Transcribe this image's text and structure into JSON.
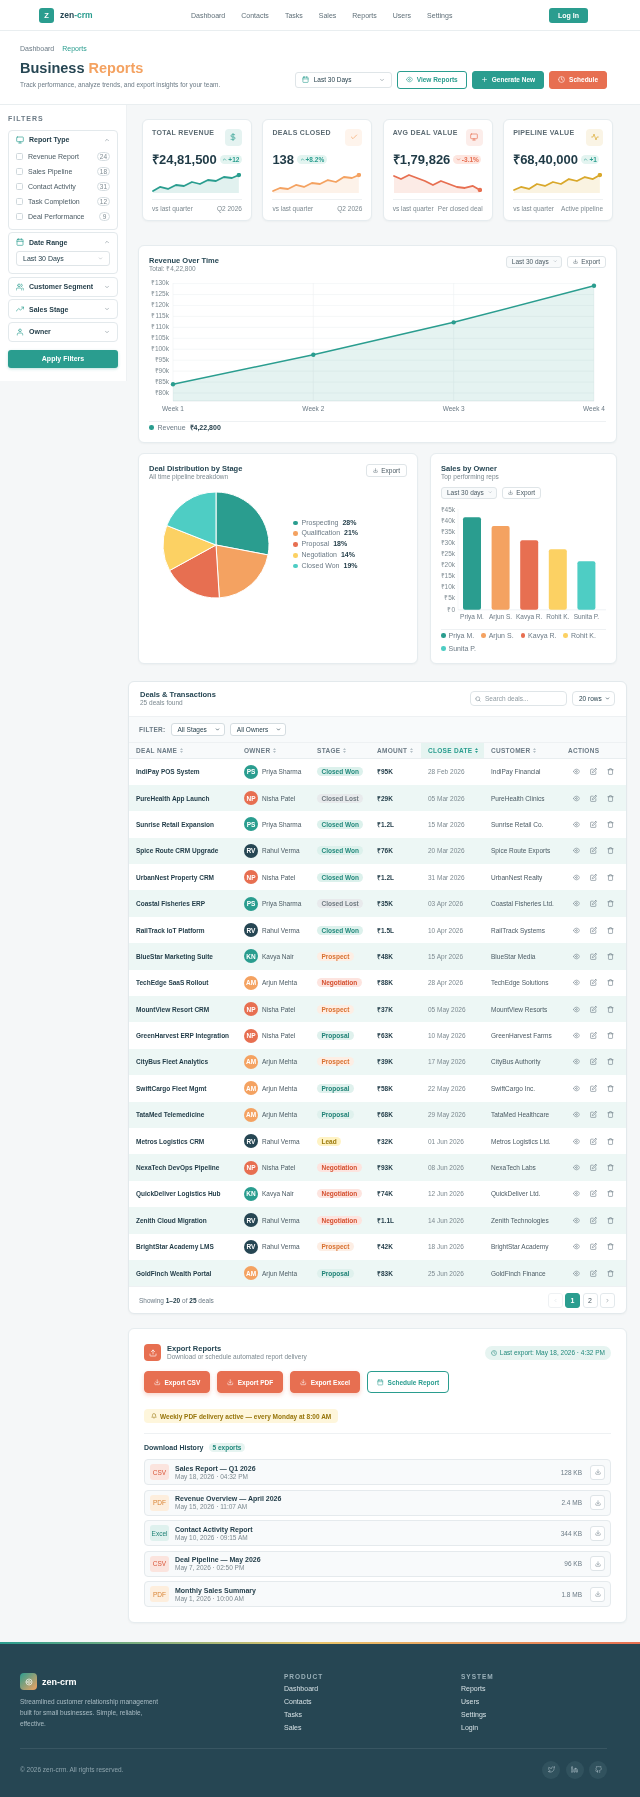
{
  "header": {
    "logo_letter": "Z",
    "brand": {
      "text": "zen",
      "accent": "-crm"
    },
    "nav": [
      {
        "label": "Dashboard",
        "selected": false
      },
      {
        "label": "Contacts",
        "selected": false
      },
      {
        "label": "Tasks",
        "selected": false
      },
      {
        "label": "Sales",
        "selected": false
      },
      {
        "label": "Reports",
        "selected": false
      },
      {
        "label": "Users",
        "selected": false
      },
      {
        "label": "Settings",
        "selected": false
      }
    ],
    "login": "Log In"
  },
  "page_header": {
    "breadcrumb": [
      {
        "label": "Dashboard",
        "current": false
      },
      {
        "label": "Reports",
        "current": true
      }
    ],
    "title": {
      "text": "Business",
      "accent": "Reports"
    },
    "subtitle": "Track performance, analyze trends, and export insights for your team.",
    "date_select": "Last 30 Days",
    "buttons": [
      {
        "label": "View Reports",
        "kind": "outline"
      },
      {
        "label": "Generate New",
        "kind": "primary"
      },
      {
        "label": "Schedule",
        "kind": "accent"
      }
    ]
  },
  "sidebar": {
    "heading": "FILTERS",
    "groups": [
      {
        "title": "Report Type",
        "expanded": true,
        "kind": "checklist",
        "options": [
          {
            "label": "Revenue Report",
            "count": "24",
            "checked": false
          },
          {
            "label": "Sales Pipeline",
            "count": "18",
            "checked": false
          },
          {
            "label": "Contact Activity",
            "count": "31",
            "checked": false
          },
          {
            "label": "Task Completion",
            "count": "12",
            "checked": false
          },
          {
            "label": "Deal Performance",
            "count": "9",
            "checked": false
          }
        ]
      },
      {
        "title": "Date Range",
        "expanded": true,
        "kind": "select",
        "value": "Last 30 Days"
      },
      {
        "title": "Customer Segment",
        "expanded": false
      },
      {
        "title": "Sales Stage",
        "expanded": false
      },
      {
        "title": "Owner",
        "expanded": false
      }
    ],
    "apply": "Apply Filters"
  },
  "kpis": [
    {
      "label": "TOTAL REVENUE",
      "value": "₹24,81,500",
      "delta": "+12",
      "rising": true,
      "color": "#2a9d8f",
      "note_left": "vs last quarter",
      "note_right": "Q2 2026"
    },
    {
      "label": "DEALS CLOSED",
      "value": "138",
      "delta": "+8.2%",
      "rising": true,
      "color": "#f4a261",
      "note_left": "vs last quarter",
      "note_right": "Q2 2026"
    },
    {
      "label": "AVG DEAL VALUE",
      "value": "₹1,79,826",
      "delta": "-3.1%",
      "rising": false,
      "color": "#e76f51",
      "note_left": "vs last quarter",
      "note_right": "Per closed deal"
    },
    {
      "label": "PIPELINE VALUE",
      "value": "₹68,40,000",
      "delta": "+1",
      "rising": true,
      "color": "#d9a82b",
      "note_left": "vs last quarter",
      "note_right": "Active pipeline"
    }
  ],
  "revenue_chart": {
    "subtitle": "Total: ₹4,22,800",
    "range_select": "Last 30 days",
    "export": "Export",
    "legend_value": "₹4,22,800",
    "chart_data": {
      "type": "area",
      "title": "Revenue Over Time",
      "categories": [
        "Week 1",
        "Week 2",
        "Week 3",
        "Week 4"
      ],
      "series": [
        {
          "name": "Revenue",
          "color": "#2a9d8f",
          "values": [
            84000,
            97500,
            112300,
            129000
          ]
        }
      ],
      "ylim": [
        80000,
        130000
      ],
      "yticks": [
        {
          "value": 80000,
          "label": "₹80k"
        },
        {
          "value": 85000,
          "label": "₹85k"
        },
        {
          "value": 90000,
          "label": "₹90k"
        },
        {
          "value": 95000,
          "label": "₹95k"
        },
        {
          "value": 100000,
          "label": "₹100k"
        },
        {
          "value": 105000,
          "label": "₹105k"
        },
        {
          "value": 110000,
          "label": "₹110k"
        },
        {
          "value": 115000,
          "label": "₹115k"
        },
        {
          "value": 120000,
          "label": "₹120k"
        },
        {
          "value": 125000,
          "label": "₹125k"
        },
        {
          "value": 130000,
          "label": "₹130k"
        }
      ],
      "grid": true,
      "legend": "bottom"
    }
  },
  "deal_distribution": {
    "subtitle": "All time pipeline breakdown",
    "export": "Export",
    "chart_data": {
      "type": "pie",
      "title": "Deal Distribution by Stage",
      "categories": [
        "Prospecting",
        "Qualification",
        "Proposal",
        "Negotiation",
        "Closed Won"
      ],
      "values": [
        28,
        21,
        18,
        14,
        19
      ],
      "legend": "right"
    },
    "legend_items": [
      {
        "value": "28%",
        "color": "#2a9d8f"
      },
      {
        "value": "21%",
        "color": "#f4a261"
      },
      {
        "value": "18%",
        "color": "#e76f51"
      },
      {
        "value": "14%",
        "color": "#fcd163"
      },
      {
        "value": "19%",
        "color": "#4ecdc4"
      }
    ]
  },
  "sales_by_owner": {
    "subtitle": "Top performing reps",
    "range_select": "Last 30 days",
    "export": "Export",
    "chart_data": {
      "type": "bar",
      "title": "Sales by Owner",
      "categories": [
        "Priya M.",
        "Arjun S.",
        "Kavya R.",
        "Rohit K.",
        "Sunita P."
      ],
      "values": [
        42000,
        38000,
        31500,
        27500,
        22000
      ],
      "ylim": [
        0,
        45000
      ],
      "yticks": [
        {
          "value": 0,
          "label": "₹0"
        },
        {
          "value": 5000,
          "label": "₹5k"
        },
        {
          "value": 10000,
          "label": "₹10k"
        },
        {
          "value": 15000,
          "label": "₹15k"
        },
        {
          "value": 20000,
          "label": "₹20k"
        },
        {
          "value": 25000,
          "label": "₹25k"
        },
        {
          "value": 30000,
          "label": "₹30k"
        },
        {
          "value": 35000,
          "label": "₹35k"
        },
        {
          "value": 40000,
          "label": "₹40k"
        },
        {
          "value": 45000,
          "label": "₹45k"
        }
      ]
    },
    "legend_items": [
      {
        "label": "Priya M.",
        "color": "#2a9d8f"
      },
      {
        "label": "Arjun S.",
        "color": "#f4a261"
      },
      {
        "label": "Kavya R.",
        "color": "#e76f51"
      },
      {
        "label": "Rohit K.",
        "color": "#fcd163"
      },
      {
        "label": "Sunita P.",
        "color": "#4ecdc4"
      }
    ]
  },
  "deals_table": {
    "title": "Deals & Transactions",
    "count": "25 deals found",
    "search_placeholder": "Search deals...",
    "rows_select": "20 rows",
    "filter_label": "FILTER:",
    "filters": [
      "All Stages",
      "All Owners"
    ],
    "columns": [
      {
        "label": "DEAL NAME",
        "sortable": true,
        "sorted": false
      },
      {
        "label": "OWNER",
        "sortable": true,
        "sorted": false
      },
      {
        "label": "STAGE",
        "sortable": true,
        "sorted": false
      },
      {
        "label": "AMOUNT",
        "sortable": true,
        "sorted": false
      },
      {
        "label": "CLOSE DATE",
        "sortable": true,
        "sorted": true
      },
      {
        "label": "CUSTOMER",
        "sortable": true,
        "sorted": false
      },
      {
        "label": "ACTIONS",
        "sortable": false,
        "sorted": false
      }
    ],
    "rows": [
      {
        "deal": "IndiPay POS System",
        "owner": {
          "initials": "PS",
          "name": "Priya Sharma",
          "color": "#2a9d8f"
        },
        "stage": {
          "label": "Closed Won",
          "kind": "won"
        },
        "amount": "₹95K",
        "close_date": "28 Feb 2026",
        "customer": "IndiPay Financial"
      },
      {
        "deal": "PureHealth App Launch",
        "owner": {
          "initials": "NP",
          "name": "Nisha Patel",
          "color": "#e76f51"
        },
        "stage": {
          "label": "Closed Lost",
          "kind": "lost"
        },
        "amount": "₹29K",
        "close_date": "05 Mar 2026",
        "customer": "PureHealth Clinics"
      },
      {
        "deal": "Sunrise Retail Expansion",
        "owner": {
          "initials": "PS",
          "name": "Priya Sharma",
          "color": "#2a9d8f"
        },
        "stage": {
          "label": "Closed Won",
          "kind": "won"
        },
        "amount": "₹1.2L",
        "close_date": "15 Mar 2026",
        "customer": "Sunrise Retail Co."
      },
      {
        "deal": "Spice Route CRM Upgrade",
        "owner": {
          "initials": "RV",
          "name": "Rahul Verma",
          "color": "#264653"
        },
        "stage": {
          "label": "Closed Won",
          "kind": "won"
        },
        "amount": "₹76K",
        "close_date": "20 Mar 2026",
        "customer": "Spice Route Exports"
      },
      {
        "deal": "UrbanNest Property CRM",
        "owner": {
          "initials": "NP",
          "name": "Nisha Patel",
          "color": "#e76f51"
        },
        "stage": {
          "label": "Closed Won",
          "kind": "won"
        },
        "amount": "₹1.2L",
        "close_date": "31 Mar 2026",
        "customer": "UrbanNest Realty"
      },
      {
        "deal": "Coastal Fisheries ERP",
        "owner": {
          "initials": "PS",
          "name": "Priya Sharma",
          "color": "#2a9d8f"
        },
        "stage": {
          "label": "Closed Lost",
          "kind": "lost"
        },
        "amount": "₹35K",
        "close_date": "03 Apr 2026",
        "customer": "Coastal Fisheries Ltd."
      },
      {
        "deal": "RailTrack IoT Platform",
        "owner": {
          "initials": "RV",
          "name": "Rahul Verma",
          "color": "#264653"
        },
        "stage": {
          "label": "Closed Won",
          "kind": "won"
        },
        "amount": "₹1.5L",
        "close_date": "10 Apr 2026",
        "customer": "RailTrack Systems"
      },
      {
        "deal": "BlueStar Marketing Suite",
        "owner": {
          "initials": "KN",
          "name": "Kavya Nair",
          "color": "#2a9d8f"
        },
        "stage": {
          "label": "Prospect",
          "kind": "prospect"
        },
        "amount": "₹48K",
        "close_date": "15 Apr 2026",
        "customer": "BlueStar Media"
      },
      {
        "deal": "TechEdge SaaS Rollout",
        "owner": {
          "initials": "AM",
          "name": "Arjun Mehta",
          "color": "#f4a261"
        },
        "stage": {
          "label": "Negotiation",
          "kind": "negotiation"
        },
        "amount": "₹88K",
        "close_date": "28 Apr 2026",
        "customer": "TechEdge Solutions"
      },
      {
        "deal": "MountView Resort CRM",
        "owner": {
          "initials": "NP",
          "name": "Nisha Patel",
          "color": "#e76f51"
        },
        "stage": {
          "label": "Prospect",
          "kind": "prospect"
        },
        "amount": "₹37K",
        "close_date": "05 May 2026",
        "customer": "MountView Resorts"
      },
      {
        "deal": "GreenHarvest ERP Integration",
        "owner": {
          "initials": "NP",
          "name": "Nisha Patel",
          "color": "#e76f51"
        },
        "stage": {
          "label": "Proposal",
          "kind": "proposal"
        },
        "amount": "₹63K",
        "close_date": "10 May 2026",
        "customer": "GreenHarvest Farms"
      },
      {
        "deal": "CityBus Fleet Analytics",
        "owner": {
          "initials": "AM",
          "name": "Arjun Mehta",
          "color": "#f4a261"
        },
        "stage": {
          "label": "Prospect",
          "kind": "prospect"
        },
        "amount": "₹39K",
        "close_date": "17 May 2026",
        "customer": "CityBus Authority"
      },
      {
        "deal": "SwiftCargo Fleet Mgmt",
        "owner": {
          "initials": "AM",
          "name": "Arjun Mehta",
          "color": "#f4a261"
        },
        "stage": {
          "label": "Proposal",
          "kind": "proposal"
        },
        "amount": "₹58K",
        "close_date": "22 May 2026",
        "customer": "SwiftCargo Inc."
      },
      {
        "deal": "TataMed Telemedicine",
        "owner": {
          "initials": "AM",
          "name": "Arjun Mehta",
          "color": "#f4a261"
        },
        "stage": {
          "label": "Proposal",
          "kind": "proposal"
        },
        "amount": "₹68K",
        "close_date": "29 May 2026",
        "customer": "TataMed Healthcare"
      },
      {
        "deal": "Metros Logistics CRM",
        "owner": {
          "initials": "RV",
          "name": "Rahul Verma",
          "color": "#264653"
        },
        "stage": {
          "label": "Lead",
          "kind": "lead"
        },
        "amount": "₹32K",
        "close_date": "01 Jun 2026",
        "customer": "Metros Logistics Ltd."
      },
      {
        "deal": "NexaTech DevOps Pipeline",
        "owner": {
          "initials": "NP",
          "name": "Nisha Patel",
          "color": "#e76f51"
        },
        "stage": {
          "label": "Negotiation",
          "kind": "negotiation"
        },
        "amount": "₹93K",
        "close_date": "08 Jun 2026",
        "customer": "NexaTech Labs"
      },
      {
        "deal": "QuickDeliver Logistics Hub",
        "owner": {
          "initials": "KN",
          "name": "Kavya Nair",
          "color": "#2a9d8f"
        },
        "stage": {
          "label": "Negotiation",
          "kind": "negotiation"
        },
        "amount": "₹74K",
        "close_date": "12 Jun 2026",
        "customer": "QuickDeliver Ltd."
      },
      {
        "deal": "Zenith Cloud Migration",
        "owner": {
          "initials": "RV",
          "name": "Rahul Verma",
          "color": "#264653"
        },
        "stage": {
          "label": "Negotiation",
          "kind": "negotiation"
        },
        "amount": "₹1.1L",
        "close_date": "14 Jun 2026",
        "customer": "Zenith Technologies"
      },
      {
        "deal": "BrightStar Academy LMS",
        "owner": {
          "initials": "RV",
          "name": "Rahul Verma",
          "color": "#264653"
        },
        "stage": {
          "label": "Prospect",
          "kind": "prospect"
        },
        "amount": "₹42K",
        "close_date": "18 Jun 2026",
        "customer": "BrightStar Academy"
      },
      {
        "deal": "GoldFinch Wealth Portal",
        "owner": {
          "initials": "AM",
          "name": "Arjun Mehta",
          "color": "#f4a261"
        },
        "stage": {
          "label": "Proposal",
          "kind": "proposal"
        },
        "amount": "₹83K",
        "close_date": "25 Jun 2026",
        "customer": "GoldFinch Finance"
      }
    ],
    "summary": "Showing **1–20** of **25** deals",
    "pagination": {
      "prev": {
        "disabled": true
      },
      "pages": [
        {
          "label": "1",
          "selected": true
        },
        {
          "label": "2",
          "selected": false
        }
      ],
      "next": {
        "disabled": false
      }
    }
  },
  "export_reports": {
    "title": "Export Reports",
    "subtitle": "Download or schedule automated report delivery",
    "last_export": "Last export: May 18, 2026 · 4:32 PM",
    "buttons": [
      {
        "label": "Export CSV",
        "kind": "solid"
      },
      {
        "label": "Export PDF",
        "kind": "solid"
      },
      {
        "label": "Export Excel",
        "kind": "solid"
      },
      {
        "label": "Schedule Report",
        "kind": "outline"
      }
    ],
    "notice": "Weekly PDF delivery active — every Monday at 8:00 AM",
    "history_title": "Download History",
    "history_count": "5 exports",
    "history": [
      {
        "type": "CSV",
        "kind": "csv",
        "name": "Sales Report — Q1 2026",
        "date": "May 18, 2026 · 04:32 PM",
        "size": "128 KB"
      },
      {
        "type": "PDF",
        "kind": "pdf",
        "name": "Revenue Overview — April 2026",
        "date": "May 15, 2026 · 11:07 AM",
        "size": "2.4 MB"
      },
      {
        "type": "Excel",
        "kind": "excel",
        "name": "Contact Activity Report",
        "date": "May 10, 2026 · 09:15 AM",
        "size": "344 KB"
      },
      {
        "type": "CSV",
        "kind": "csv",
        "name": "Deal Pipeline — May 2026",
        "date": "May 7, 2026 · 02:50 PM",
        "size": "96 KB"
      },
      {
        "type": "PDF",
        "kind": "pdf",
        "name": "Monthly Sales Summary",
        "date": "May 1, 2026 · 10:00 AM",
        "size": "1.8 MB"
      }
    ]
  },
  "footer": {
    "brand": "zen-crm",
    "description": "Streamlined customer relationship management built for small businesses. Simple, reliable, effective.",
    "columns": [
      {
        "heading": "PRODUCT",
        "links": [
          "Dashboard",
          "Contacts",
          "Tasks",
          "Sales"
        ]
      },
      {
        "heading": "SYSTEM",
        "links": [
          "Reports",
          "Users",
          "Settings",
          "Login"
        ]
      }
    ],
    "copyright": "© 2026 zen-crm. All rights reserved."
  }
}
